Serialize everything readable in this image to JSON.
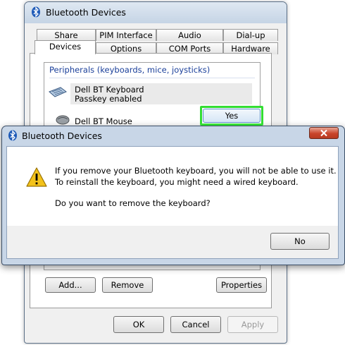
{
  "bg_window": {
    "title": "Bluetooth Devices",
    "tabs_row1": [
      "Share",
      "PIM Interface",
      "Audio",
      "Dial-up"
    ],
    "tabs_row2": [
      "Devices",
      "Options",
      "COM Ports",
      "Hardware"
    ],
    "active_tab": "Devices",
    "group_header": "Peripherals (keyboards, mice, joysticks)",
    "devices": [
      {
        "name": "Dell BT Keyboard",
        "status": "Passkey enabled",
        "icon": "keyboard-icon"
      },
      {
        "name": "Dell BT Mouse",
        "status": "",
        "icon": "mouse-icon"
      }
    ],
    "buttons": {
      "add": "Add...",
      "remove": "Remove",
      "properties": "Properties",
      "ok": "OK",
      "cancel": "Cancel",
      "apply": "Apply"
    }
  },
  "dialog": {
    "title": "Bluetooth Devices",
    "message_line1": "If you remove your Bluetooth keyboard, you will not be able to use it.",
    "message_line2": "To reinstall the keyboard, you might need a wired keyboard.",
    "question": "Do you want to remove the keyboard?",
    "yes_label": "Yes",
    "no_label": "No",
    "icon": "warning-icon"
  },
  "colors": {
    "highlight_border": "#33dd33",
    "group_header": "#1a3f9a",
    "close_button": "#c9452b"
  }
}
